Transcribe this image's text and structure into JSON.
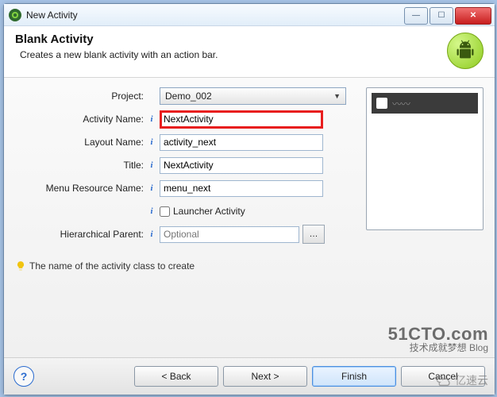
{
  "window": {
    "title": "New Activity"
  },
  "header": {
    "title": "Blank Activity",
    "subtitle": "Creates a new blank activity with an action bar."
  },
  "form": {
    "project": {
      "label": "Project:",
      "value": "Demo_002"
    },
    "activity_name": {
      "label": "Activity Name:",
      "value": "NextActivity"
    },
    "layout_name": {
      "label": "Layout Name:",
      "value": "activity_next"
    },
    "title_field": {
      "label": "Title:",
      "value": "NextActivity"
    },
    "menu_resource": {
      "label": "Menu Resource Name:",
      "value": "menu_next"
    },
    "launcher": {
      "label": "Launcher Activity",
      "checked": false
    },
    "hier_parent": {
      "label": "Hierarchical Parent:",
      "placeholder": "Optional"
    }
  },
  "hint": "The name of the activity class to create",
  "buttons": {
    "back": "< Back",
    "next": "Next >",
    "finish": "Finish",
    "cancel": "Cancel",
    "help": "?"
  },
  "watermarks": {
    "w1_big": "51CTO.com",
    "w1_small": "技术成就梦想 Blog",
    "w2": "亿速云"
  }
}
